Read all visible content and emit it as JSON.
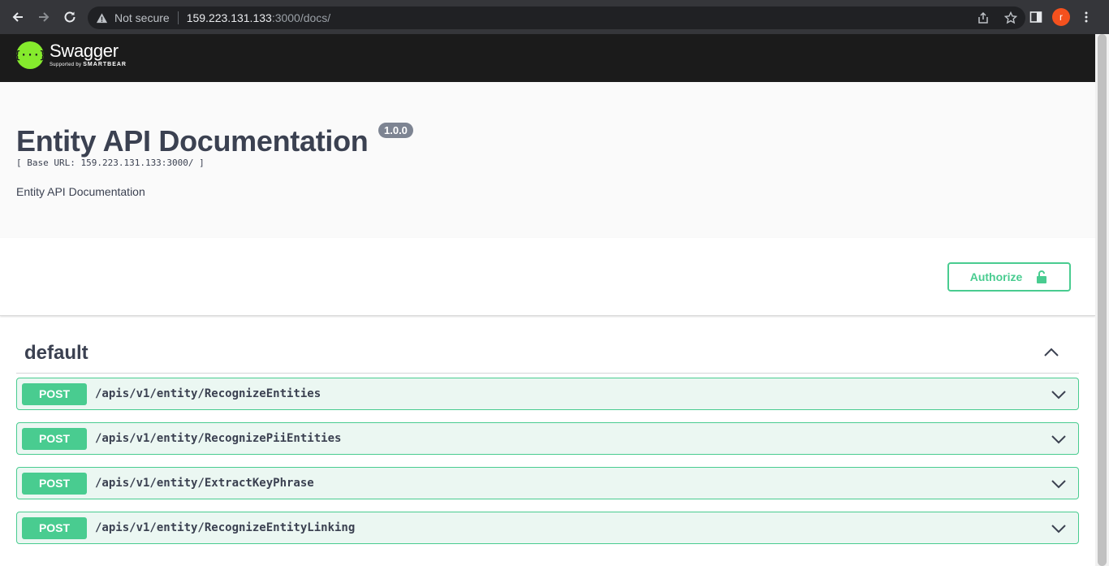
{
  "browser": {
    "security_label": "Not secure",
    "url_host": "159.223.131.133",
    "url_rest": ":3000/docs/",
    "avatar_letter": "r"
  },
  "topbar": {
    "logo_name": "Swagger",
    "logo_sub_prefix": "Supported by",
    "logo_sub_brand": "SMARTBEAR",
    "logo_glyph": "{···}"
  },
  "info": {
    "title": "Entity API Documentation",
    "version": "1.0.0",
    "base_url": "[ Base URL: 159.223.131.133:3000/ ]",
    "description": "Entity API Documentation"
  },
  "scheme": {
    "authorize_label": "Authorize"
  },
  "tag": {
    "name": "default",
    "operations": [
      {
        "method": "POST",
        "path": "/apis/v1/entity/RecognizeEntities"
      },
      {
        "method": "POST",
        "path": "/apis/v1/entity/RecognizePiiEntities"
      },
      {
        "method": "POST",
        "path": "/apis/v1/entity/ExtractKeyPhrase"
      },
      {
        "method": "POST",
        "path": "/apis/v1/entity/RecognizeEntityLinking"
      }
    ]
  },
  "colors": {
    "post_green": "#49cc90",
    "post_bg": "#ebf7f2",
    "text_dark": "#3b4151",
    "logo_green": "#85ea2d"
  }
}
